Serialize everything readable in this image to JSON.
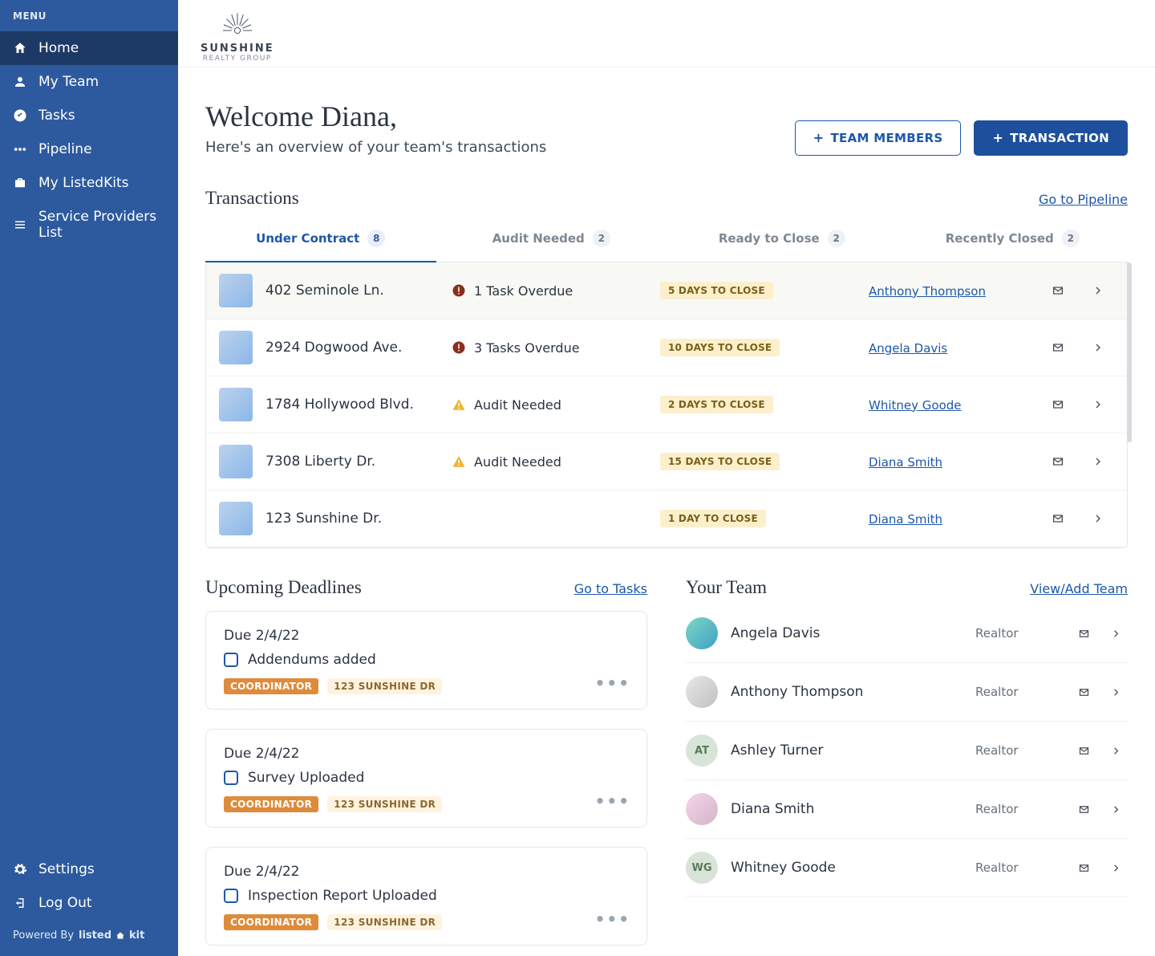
{
  "sidebar": {
    "menu_label": "MENU",
    "items": [
      {
        "label": "Home",
        "icon": "home-icon",
        "active": true
      },
      {
        "label": "My Team",
        "icon": "user-icon"
      },
      {
        "label": "Tasks",
        "icon": "check-circle-icon"
      },
      {
        "label": "Pipeline",
        "icon": "flow-icon"
      },
      {
        "label": "My ListedKits",
        "icon": "briefcase-icon"
      },
      {
        "label": "Service Providers List",
        "icon": "list-icon"
      }
    ],
    "bottom_items": [
      {
        "label": "Settings",
        "icon": "gear-icon"
      },
      {
        "label": "Log Out",
        "icon": "logout-icon"
      }
    ],
    "powered_by_prefix": "Powered By",
    "powered_by_brand": "listed",
    "powered_by_brand_suffix": "kit"
  },
  "logo": {
    "text": "SUNSHINE",
    "sub": "REALTY GROUP"
  },
  "header": {
    "welcome": "Welcome Diana,",
    "subtitle": "Here's an overview of your team's transactions",
    "btn_team": "TEAM MEMBERS",
    "btn_transaction": "TRANSACTION"
  },
  "transactions": {
    "title": "Transactions",
    "link": "Go to Pipeline",
    "tabs": [
      {
        "label": "Under Contract",
        "count": "8",
        "active": true
      },
      {
        "label": "Audit Needed",
        "count": "2"
      },
      {
        "label": "Ready to Close",
        "count": "2"
      },
      {
        "label": "Recently Closed",
        "count": "2"
      }
    ],
    "rows": [
      {
        "address": "402 Seminole Ln.",
        "status_icon": "alert-circle-icon",
        "status_text": "1 Task Overdue",
        "close": "5 DAYS TO CLOSE",
        "agent": "Anthony Thompson"
      },
      {
        "address": "2924 Dogwood Ave.",
        "status_icon": "alert-circle-icon",
        "status_text": "3 Tasks Overdue",
        "close": "10 DAYS TO CLOSE",
        "agent": "Angela Davis"
      },
      {
        "address": "1784 Hollywood Blvd.",
        "status_icon": "warning-icon",
        "status_text": "Audit Needed",
        "close": "2 DAYS TO CLOSE",
        "agent": "Whitney Goode"
      },
      {
        "address": "7308 Liberty Dr.",
        "status_icon": "warning-icon",
        "status_text": "Audit Needed",
        "close": "15 DAYS TO CLOSE",
        "agent": "Diana Smith"
      },
      {
        "address": "123 Sunshine Dr.",
        "status_icon": "",
        "status_text": "",
        "close": "1 DAY TO CLOSE",
        "agent": "Diana Smith"
      }
    ]
  },
  "deadlines": {
    "title": "Upcoming Deadlines",
    "link": "Go to Tasks",
    "cards": [
      {
        "due": "Due 2/4/22",
        "task": "Addendums added",
        "pill1": "COORDINATOR",
        "pill2": "123 SUNSHINE DR"
      },
      {
        "due": "Due 2/4/22",
        "task": "Survey Uploaded",
        "pill1": "COORDINATOR",
        "pill2": "123 SUNSHINE DR"
      },
      {
        "due": "Due 2/4/22",
        "task": "Inspection Report Uploaded",
        "pill1": "COORDINATOR",
        "pill2": "123 SUNSHINE DR"
      }
    ]
  },
  "team": {
    "title": "Your Team",
    "link": "View/Add Team",
    "members": [
      {
        "name": "Angela Davis",
        "role": "Realtor",
        "avatar": "img"
      },
      {
        "name": "Anthony Thompson",
        "role": "Realtor",
        "avatar": "img2"
      },
      {
        "name": "Ashley Turner",
        "role": "Realtor",
        "initials": "AT"
      },
      {
        "name": "Diana Smith",
        "role": "Realtor",
        "avatar": "img3"
      },
      {
        "name": "Whitney Goode",
        "role": "Realtor",
        "initials": "WG"
      }
    ]
  }
}
